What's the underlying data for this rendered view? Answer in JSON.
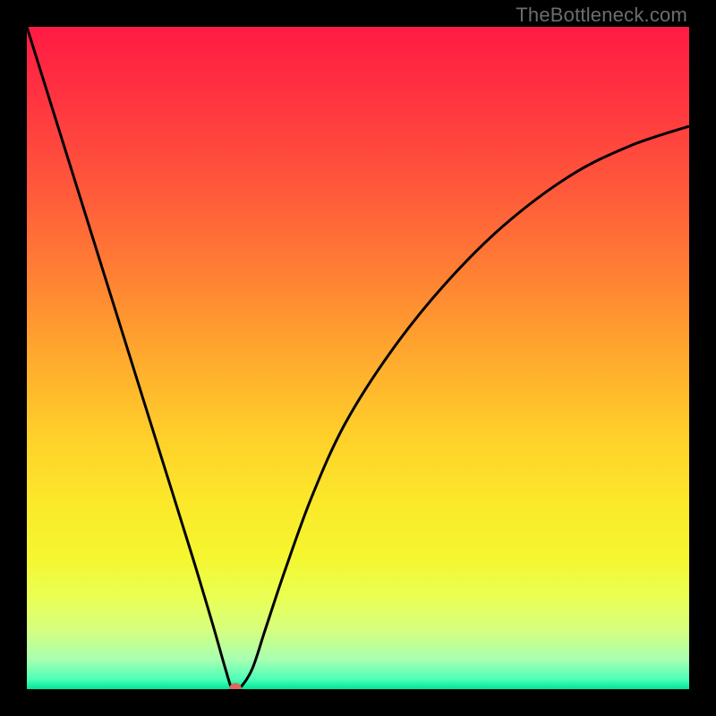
{
  "watermark": "TheBottleneck.com",
  "chart_data": {
    "type": "line",
    "title": "",
    "xlabel": "",
    "ylabel": "",
    "xlim": [
      0,
      100
    ],
    "ylim": [
      0,
      100
    ],
    "gradient_stops": [
      {
        "offset": 0.0,
        "color": "#ff1b44"
      },
      {
        "offset": 0.12,
        "color": "#ff3740"
      },
      {
        "offset": 0.25,
        "color": "#ff5a3a"
      },
      {
        "offset": 0.38,
        "color": "#ff8233"
      },
      {
        "offset": 0.5,
        "color": "#ffaa2e"
      },
      {
        "offset": 0.62,
        "color": "#ffd02a"
      },
      {
        "offset": 0.72,
        "color": "#fbe92a"
      },
      {
        "offset": 0.8,
        "color": "#f5f62f"
      },
      {
        "offset": 0.86,
        "color": "#eaff52"
      },
      {
        "offset": 0.91,
        "color": "#d6ff7e"
      },
      {
        "offset": 0.955,
        "color": "#a8ffb1"
      },
      {
        "offset": 0.985,
        "color": "#4dffb8"
      },
      {
        "offset": 1.0,
        "color": "#00e598"
      }
    ],
    "series": [
      {
        "name": "bottleneck-curve",
        "x": [
          0,
          5,
          10,
          15,
          20,
          25,
          28,
          30,
          31,
          32,
          34,
          36,
          39,
          43,
          48,
          55,
          63,
          72,
          82,
          91,
          100
        ],
        "values": [
          100,
          84,
          68,
          52,
          36,
          20,
          10,
          3,
          0,
          0,
          3,
          9,
          18,
          29,
          40,
          51,
          61,
          70,
          77.5,
          82,
          85
        ]
      }
    ],
    "minimum_point": {
      "x": 31.5,
      "y": 0
    },
    "dot_color": "#d86a5f",
    "curve_color": "#000000",
    "curve_width": 3
  }
}
